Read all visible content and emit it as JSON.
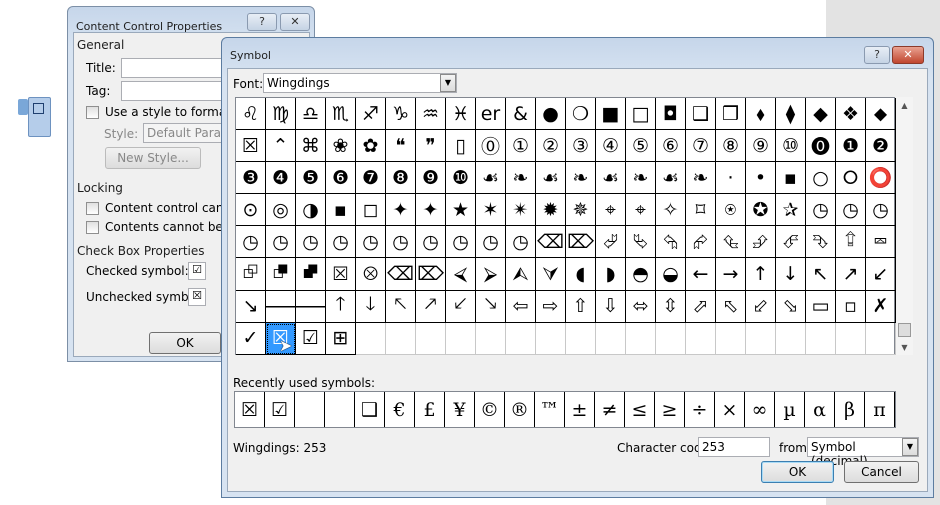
{
  "content_control_dialog": {
    "title": "Content Control Properties",
    "help": "?",
    "close": "✕",
    "general_label": "General",
    "title_label": "Title:",
    "title_value": "",
    "tag_label": "Tag:",
    "tag_value": "",
    "use_style_label": "Use a style to format co",
    "style_label": "Style:",
    "style_value": "Default Paragra",
    "new_style_label": "New Style...",
    "locking_label": "Locking",
    "lock_delete_label": "Content control cannot b",
    "lock_edit_label": "Contents cannot be edit",
    "checkbox_props_label": "Check Box Properties",
    "checked_symbol_label": "Checked symbol:",
    "checked_symbol": "☑",
    "unchecked_symbol_label": "Unchecked symbol:",
    "unchecked_symbol": "☒",
    "ok": "OK"
  },
  "symbol_dialog": {
    "title": "Symbol",
    "help": "?",
    "close": "✕",
    "font_label": "Font:",
    "font_value": "Wingdings",
    "symbols": [
      "♌",
      "♍",
      "♎",
      "♏",
      "♐",
      "♑",
      "♒",
      "♓",
      "er",
      "&",
      "●",
      "❍",
      "■",
      "□",
      "◘",
      "❑",
      "❒",
      "⬧",
      "⧫",
      "◆",
      "❖",
      "⬥",
      "☒",
      "⌃",
      "⌘",
      "❀",
      "✿",
      "❝",
      "❞",
      "▯",
      "⓪",
      "①",
      "②",
      "③",
      "④",
      "⑤",
      "⑥",
      "⑦",
      "⑧",
      "⑨",
      "⑩",
      "⓿",
      "❶",
      "❷",
      "❸",
      "❹",
      "❺",
      "❻",
      "❼",
      "❽",
      "❾",
      "❿",
      "☙",
      "❧",
      "☙",
      "❧",
      "☙",
      "❧",
      "☙",
      "❧",
      "·",
      "•",
      "▪",
      "○",
      "⭘",
      "⭕",
      "⊙",
      "◎",
      "◑",
      "▪",
      "◻",
      "✦",
      "✦",
      "★",
      "✶",
      "✴",
      "✹",
      "✵",
      "⌖",
      "⌖",
      "✧",
      "⌑",
      "⍟",
      "✪",
      "✰",
      "◷",
      "◷",
      "◷",
      "◷",
      "◷",
      "◷",
      "◷",
      "◷",
      "◷",
      "◷",
      "◷",
      "◷",
      "◷",
      "⌫",
      "⌦",
      "⮰",
      "⮱",
      "⮲",
      "⮳",
      "⮴",
      "⮵",
      "⮶",
      "⮷",
      "⮸",
      "⮹",
      "⮺",
      "⮻",
      "⮼",
      "⮽",
      "⮾",
      "⌫",
      "⌦",
      "⮘",
      "⮚",
      "⮙",
      "⮛",
      "◖",
      "◗",
      "◓",
      "◒",
      "←",
      "→",
      "↑",
      "↓",
      "↖",
      "↗",
      "↙",
      "↘",
      "🡐",
      "🡒",
      "🡑",
      "🡓",
      "🡔",
      "🡕",
      "🡗",
      "🡖",
      "⇦",
      "⇨",
      "⇧",
      "⇩",
      "⬄",
      "⇳",
      "⬀",
      "⬁",
      "⬃",
      "⬂",
      "▭",
      "▫",
      "✗",
      "✓",
      "☒",
      "☑",
      "⊞",
      "",
      "",
      "",
      "",
      "",
      "",
      "",
      "",
      "",
      "",
      "",
      "",
      "",
      "",
      "",
      "",
      "",
      ""
    ],
    "selected_index": 155,
    "recent_label": "Recently used symbols:",
    "recent": [
      "☒",
      "☑",
      "",
      "",
      "❑",
      "€",
      "£",
      "¥",
      "©",
      "®",
      "™",
      "±",
      "≠",
      "≤",
      "≥",
      "÷",
      "×",
      "∞",
      "µ",
      "α",
      "β",
      "π"
    ],
    "status": "Wingdings: 253",
    "char_code_label": "Character code:",
    "char_code_value": "253",
    "from_label": "from:",
    "from_value": "Symbol (decimal)",
    "ok": "OK",
    "cancel": "Cancel"
  }
}
